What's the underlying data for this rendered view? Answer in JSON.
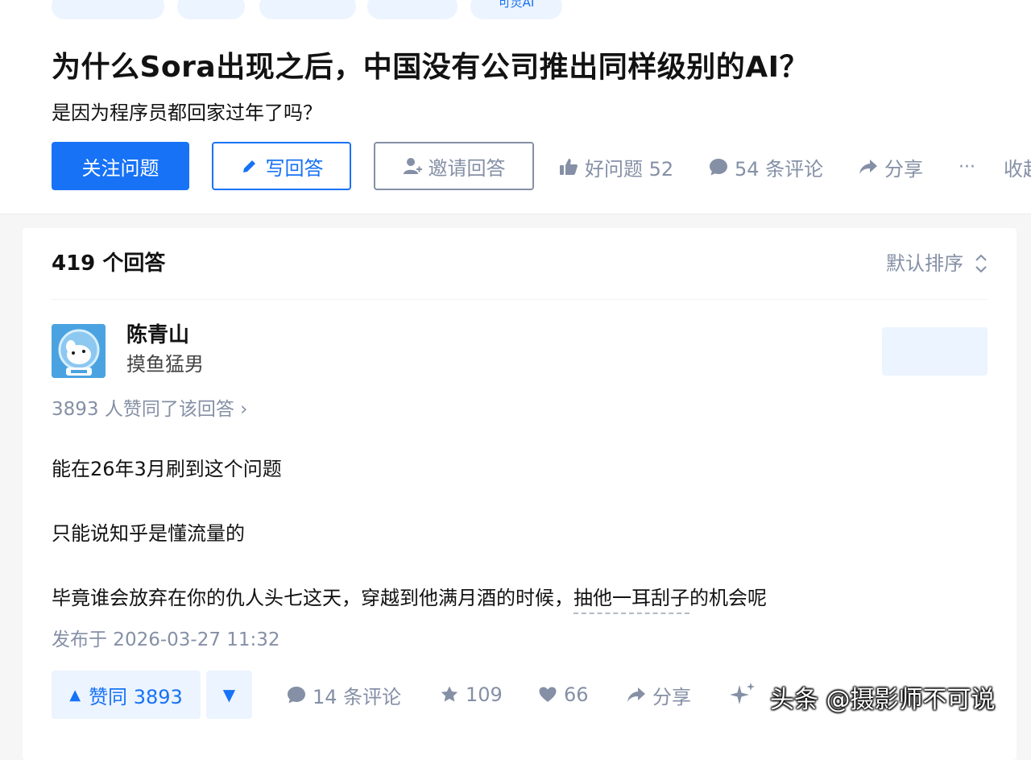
{
  "question": {
    "topic_tag_partial": "可灵AI",
    "title": "为什么Sora出现之后，中国没有公司推出同样级别的AI？",
    "detail": "是因为程序员都回家过年了吗？",
    "buttons": {
      "follow": "关注问题",
      "write": "写回答",
      "invite": "邀请回答"
    },
    "actions": {
      "good_question": "好问题 52",
      "comments": "54 条评论",
      "share": "分享",
      "more": "···",
      "collapse": "收起"
    }
  },
  "answers": {
    "count_label": "419 个回答",
    "sort_label": "默认排序"
  },
  "answer": {
    "author_name": "陈青山",
    "author_headline": "摸鱼猛男",
    "voters": "3893 人赞同了该回答 ›",
    "paragraphs": [
      "能在26年3月刷到这个问题",
      "只能说知乎是懂流量的"
    ],
    "p3_before": "毕竟谁会放弃在你的仇人头七这天，穿越到他满月酒的时候，",
    "p3_linked": "抽他一耳刮子",
    "p3_after": "的机会呢",
    "published": "发布于 2026-03-27 11:32",
    "vote_up": "赞同 3893",
    "vote_up_arrow": "▲",
    "vote_down_arrow": "▼",
    "comments": "14 条评论",
    "favorites": "109",
    "likes": "66",
    "share": "分享"
  },
  "watermark": "头条 @摄影师不可说",
  "colors": {
    "brand_blue": "#1772f6",
    "muted_gray": "#8590a6",
    "light_blue_bg": "#ecf4ff",
    "page_bg": "#f6f6f6"
  }
}
